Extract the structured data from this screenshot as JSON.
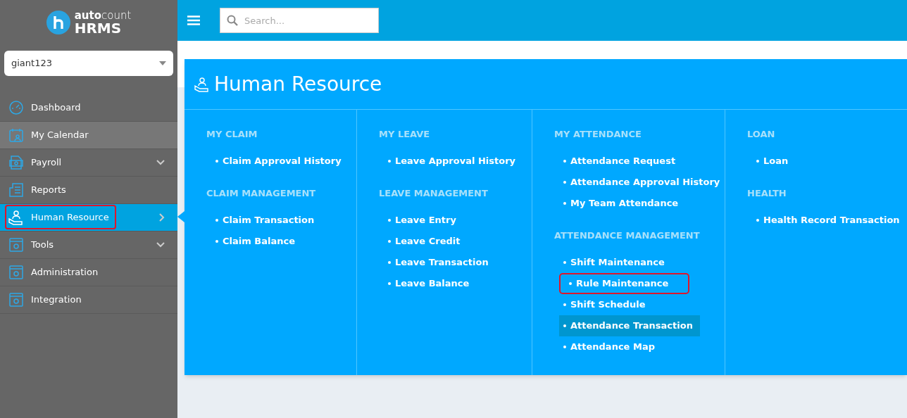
{
  "brand": {
    "wordmark_light": "auto",
    "wordmark_thin": "count",
    "product": "HRMS"
  },
  "company_select": {
    "value": "giant123"
  },
  "sidebar": {
    "items": [
      {
        "label": "Dashboard",
        "kind": "gauge",
        "selected": false,
        "hovered": false,
        "highlighted": false,
        "has_submenu": false
      },
      {
        "label": "My Calendar",
        "kind": "calendar",
        "selected": false,
        "hovered": true,
        "highlighted": false,
        "has_submenu": false
      },
      {
        "label": "Payroll",
        "kind": "money",
        "selected": false,
        "hovered": false,
        "highlighted": false,
        "has_submenu": true
      },
      {
        "label": "Reports",
        "kind": "report",
        "selected": false,
        "hovered": false,
        "highlighted": false,
        "has_submenu": false
      },
      {
        "label": "Human Resource",
        "kind": "hand",
        "selected": true,
        "hovered": false,
        "highlighted": true,
        "has_submenu": true
      },
      {
        "label": "Tools",
        "kind": "window",
        "selected": false,
        "hovered": false,
        "highlighted": false,
        "has_submenu": true
      },
      {
        "label": "Administration",
        "kind": "window",
        "selected": false,
        "hovered": false,
        "highlighted": false,
        "has_submenu": false
      },
      {
        "label": "Integration",
        "kind": "window",
        "selected": false,
        "hovered": false,
        "highlighted": false,
        "has_submenu": false
      }
    ]
  },
  "search": {
    "placeholder": "Search..."
  },
  "mega_menu": {
    "title": "Human Resource",
    "columns": [
      {
        "groups": [
          {
            "heading": "MY CLAIM",
            "links": [
              {
                "label": "Claim Approval History",
                "selected": false,
                "highlighted": false
              }
            ]
          },
          {
            "heading": "CLAIM MANAGEMENT",
            "links": [
              {
                "label": "Claim Transaction",
                "selected": false,
                "highlighted": false
              },
              {
                "label": "Claim Balance",
                "selected": false,
                "highlighted": false
              }
            ]
          }
        ]
      },
      {
        "groups": [
          {
            "heading": "MY LEAVE",
            "links": [
              {
                "label": "Leave Approval History",
                "selected": false,
                "highlighted": false
              }
            ]
          },
          {
            "heading": "LEAVE MANAGEMENT",
            "links": [
              {
                "label": "Leave Entry",
                "selected": false,
                "highlighted": false
              },
              {
                "label": "Leave Credit",
                "selected": false,
                "highlighted": false
              },
              {
                "label": "Leave Transaction",
                "selected": false,
                "highlighted": false
              },
              {
                "label": "Leave Balance",
                "selected": false,
                "highlighted": false
              }
            ]
          }
        ]
      },
      {
        "groups": [
          {
            "heading": "MY ATTENDANCE",
            "links": [
              {
                "label": "Attendance Request",
                "selected": false,
                "highlighted": false
              },
              {
                "label": "Attendance Approval History",
                "selected": false,
                "highlighted": false
              },
              {
                "label": "My Team Attendance",
                "selected": false,
                "highlighted": false
              }
            ]
          },
          {
            "heading": "ATTENDANCE MANAGEMENT",
            "links": [
              {
                "label": "Shift Maintenance",
                "selected": false,
                "highlighted": false
              },
              {
                "label": "Rule Maintenance",
                "selected": false,
                "highlighted": true
              },
              {
                "label": "Shift Schedule",
                "selected": false,
                "highlighted": false
              },
              {
                "label": "Attendance Transaction",
                "selected": true,
                "highlighted": false
              },
              {
                "label": "Attendance Map",
                "selected": false,
                "highlighted": false
              }
            ]
          }
        ]
      },
      {
        "groups": [
          {
            "heading": "LOAN",
            "links": [
              {
                "label": "Loan",
                "selected": false,
                "highlighted": false
              }
            ]
          },
          {
            "heading": "HEALTH",
            "links": [
              {
                "label": "Health Record Transaction",
                "selected": false,
                "highlighted": false
              }
            ]
          }
        ]
      }
    ]
  }
}
